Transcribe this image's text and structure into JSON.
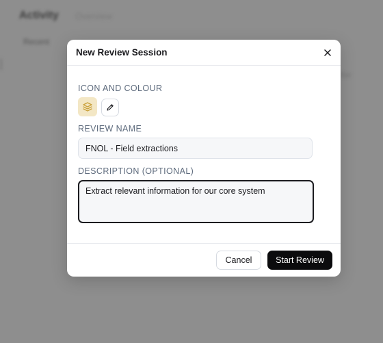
{
  "background": {
    "app_title": "Activity",
    "app_subtitle": "Overview",
    "tab_label": "Recent",
    "right_text": "Filter"
  },
  "modal": {
    "title": "New Review Session",
    "close_icon": "close-icon",
    "icon_section_label": "ICON AND COLOUR",
    "selected_icon": "layers-icon",
    "icon_color": "#c9a13b",
    "icon_bg_color": "#f3e7c5",
    "edit_icon": "pencil-icon",
    "name_label": "REVIEW NAME",
    "name_value": "FNOL - Field extractions",
    "description_label": "DESCRIPTION (OPTIONAL)",
    "description_value": "Extract relevant information for our core system",
    "cancel_label": "Cancel",
    "start_label": "Start Review"
  }
}
